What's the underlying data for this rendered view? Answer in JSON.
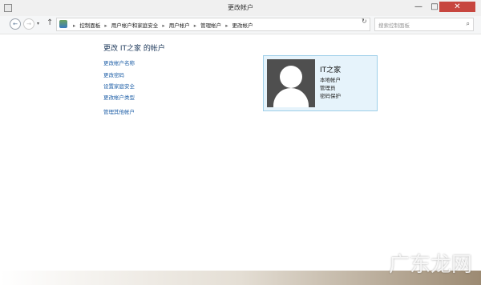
{
  "window": {
    "title": "更改帐户",
    "min_glyph": "—",
    "max_glyph": "□",
    "close_glyph": "✕"
  },
  "navbar": {
    "back_glyph": "←",
    "forward_glyph": "→",
    "recent_glyph": "▾",
    "up_glyph": "↑",
    "breadcrumbs": [
      "控制面板",
      "用户帐户和家庭安全",
      "用户帐户",
      "管理帐户",
      "更改帐户"
    ],
    "breadcrumb_separator": "▸",
    "dropdown_glyph": "▾",
    "refresh_glyph": "↻",
    "search_placeholder": "搜索控制面板",
    "search_glyph": "⌕"
  },
  "main": {
    "title": "更改 IT之家 的帐户",
    "links": [
      {
        "label": "更改帐户名称"
      },
      {
        "label": "更改密码"
      },
      {
        "label": "设置家庭安全"
      },
      {
        "label": "更改帐户类型"
      },
      {
        "label": "管理其他帐户"
      }
    ]
  },
  "account_card": {
    "name": "IT之家",
    "lines": [
      "本地帐户",
      "管理员",
      "密码保护"
    ]
  },
  "watermark": {
    "text": "广东龙网"
  }
}
